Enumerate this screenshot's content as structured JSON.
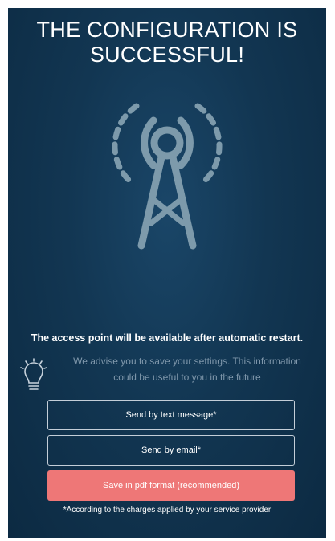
{
  "header": {
    "title_line1": "THE CONFIGURATION IS",
    "title_line2": "SUCCESSFUL!"
  },
  "illustration": {
    "icon": "antenna-tower-icon",
    "color": "#7d9aab"
  },
  "notice": {
    "text": "The access point will be available after automatic restart."
  },
  "advice": {
    "icon": "lightbulb-icon",
    "line1": "We advise you to save your settings. This information",
    "line2": "could be useful to you in the future"
  },
  "actions": {
    "sms_label": "Send by text message*",
    "email_label": "Send by email*",
    "pdf_label": "Save in pdf format (recommended)"
  },
  "footnote": {
    "text": "*According to the charges applied by your service provider"
  },
  "colors": {
    "background": "#123652",
    "accent": "#ee7777",
    "muted_text": "#7f97ab"
  }
}
